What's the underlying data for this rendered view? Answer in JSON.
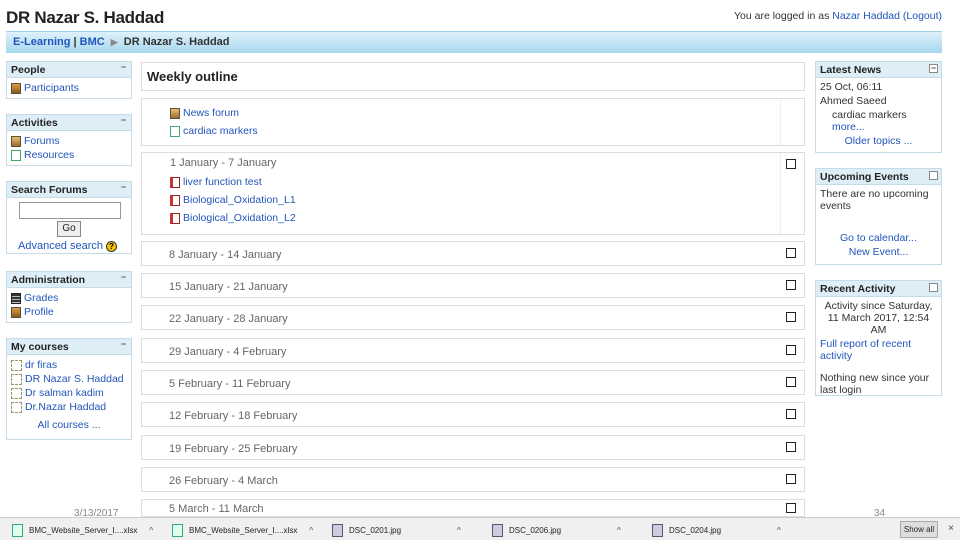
{
  "header": {
    "site_title": "DR Nazar S. Haddad",
    "login_prefix": "You are logged in as",
    "user": "Nazar Haddad",
    "logout": "(Logout)"
  },
  "breadcrumb": {
    "home": "E-Learning",
    "pipe": "|",
    "org": "BMC",
    "current": "DR Nazar S. Haddad"
  },
  "left_blocks": {
    "people": {
      "title": "People",
      "items": [
        "Participants"
      ]
    },
    "activities": {
      "title": "Activities",
      "items": [
        "Forums",
        "Resources"
      ]
    },
    "search": {
      "title": "Search Forums",
      "go": "Go",
      "advanced": "Advanced search"
    },
    "administration": {
      "title": "Administration",
      "items": [
        "Grades",
        "Profile"
      ]
    },
    "courses": {
      "title": "My courses",
      "items": [
        "dr firas",
        "DR Nazar S. Haddad",
        "Dr salman kadim",
        "Dr.Nazar Haddad"
      ],
      "all": "All courses ..."
    }
  },
  "main": {
    "title": "Weekly outline",
    "general": [
      "News forum",
      "cardiac markers"
    ],
    "week1": {
      "title": "1 January - 7 January",
      "items": [
        "liver function test",
        "Biological_Oxidation_L1",
        "Biological_Oxidation_L2"
      ]
    },
    "weeks": [
      "8 January - 14 January",
      "15 January - 21 January",
      "22 January - 28 January",
      "29 January - 4 February",
      "5 February - 11 February",
      "12 February - 18 February",
      "19 February - 25 February",
      "26 February - 4 March",
      "5 March - 11 March"
    ]
  },
  "right_blocks": {
    "news": {
      "title": "Latest News",
      "date": "25 Oct, 06:11",
      "author": "Ahmed Saeed",
      "text": "cardiac markers",
      "more": "more...",
      "older": "Older topics ..."
    },
    "events": {
      "title": "Upcoming Events",
      "text": "There are no upcoming events",
      "calendar": "Go to calendar...",
      "new": "New Event..."
    },
    "activity": {
      "title": "Recent Activity",
      "since": "Activity since Saturday, 11 March 2017, 12:54 AM",
      "report": "Full report of recent activity",
      "nothing": "Nothing new since your last login"
    }
  },
  "slide": {
    "date": "3/13/2017",
    "number": "34"
  },
  "taskbar": {
    "items": [
      "BMC_Website_Server_I....xlsx",
      "BMC_Website_Server_I....xlsx",
      "DSC_0201.jpg",
      "DSC_0206.jpg",
      "DSC_0204.jpg"
    ],
    "show_all": "Show all",
    "close": "×"
  }
}
